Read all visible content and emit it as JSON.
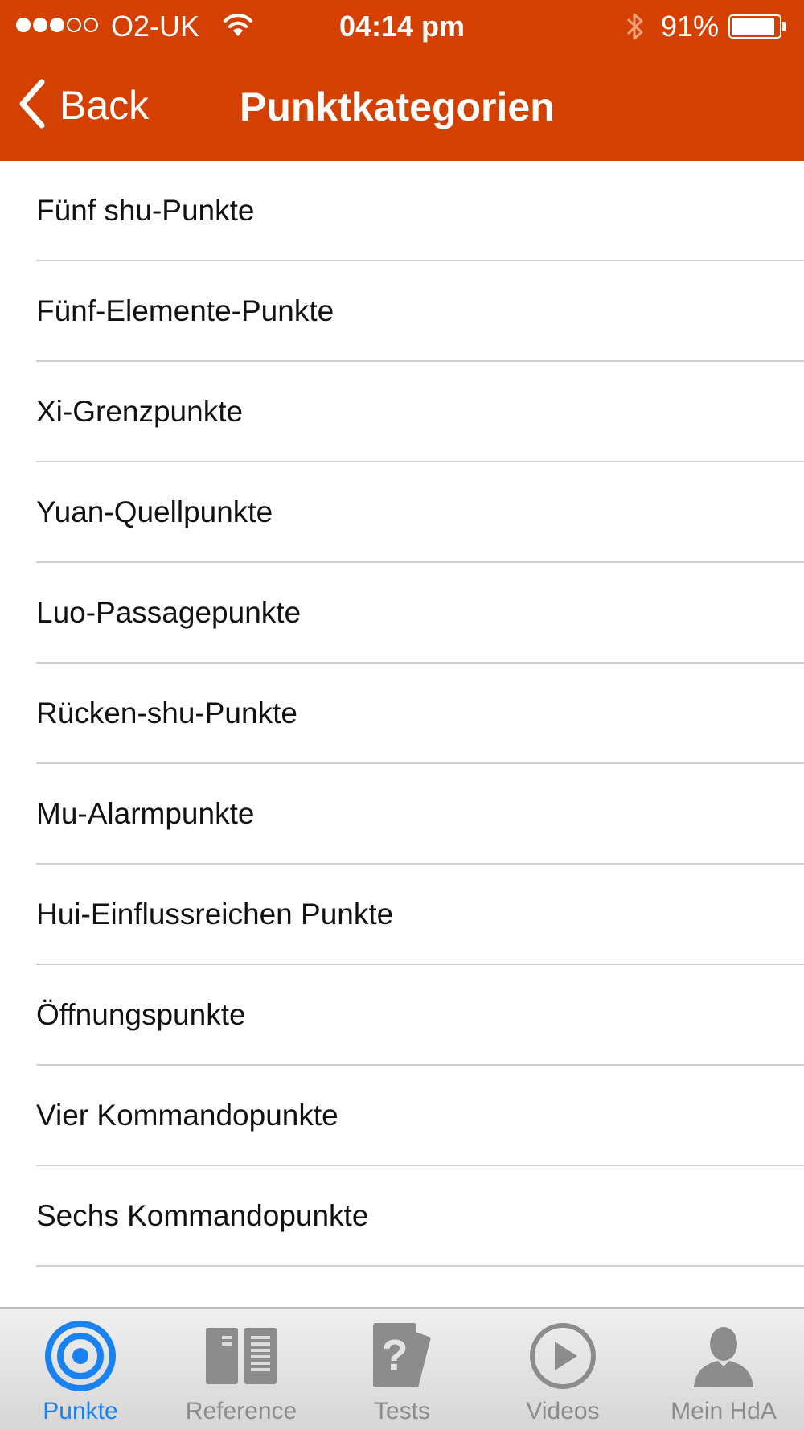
{
  "status_bar": {
    "carrier": "O2-UK",
    "time": "04:14 pm",
    "battery_percent": "91%",
    "battery_level": 0.91,
    "signal_bars_filled": 3,
    "signal_bars_total": 5
  },
  "nav": {
    "back_label": "Back",
    "title": "Punktkategorien"
  },
  "list": {
    "items": [
      {
        "label": "Fünf shu-Punkte"
      },
      {
        "label": "Fünf-Elemente-Punkte"
      },
      {
        "label": "Xi-Grenzpunkte"
      },
      {
        "label": "Yuan-Quellpunkte"
      },
      {
        "label": "Luo-Passagepunkte"
      },
      {
        "label": "Rücken-shu-Punkte"
      },
      {
        "label": "Mu-Alarmpunkte"
      },
      {
        "label": "Hui-Einflussreichen Punkte"
      },
      {
        "label": "Öffnungspunkte"
      },
      {
        "label": "Vier Kommandopunkte"
      },
      {
        "label": "Sechs Kommandopunkte"
      }
    ]
  },
  "tabs": [
    {
      "label": "Punkte",
      "icon": "target-icon",
      "active": true
    },
    {
      "label": "Reference",
      "icon": "book-icon",
      "active": false
    },
    {
      "label": "Tests",
      "icon": "question-card-icon",
      "active": false
    },
    {
      "label": "Videos",
      "icon": "play-icon",
      "active": false
    },
    {
      "label": "Mein HdA",
      "icon": "person-icon",
      "active": false
    }
  ],
  "colors": {
    "header_background": "#d44000",
    "active_tab": "#1a82f0",
    "inactive_tab": "#8c8c8c"
  }
}
